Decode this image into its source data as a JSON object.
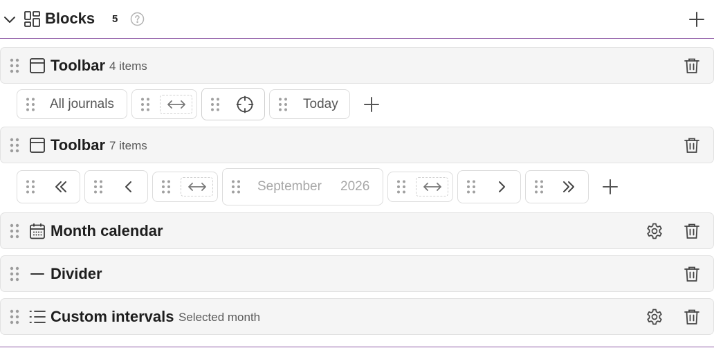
{
  "section": {
    "title": "Blocks",
    "count": "5",
    "icons": {
      "collapse": "chevron-down-icon",
      "section": "blocks-grid-icon",
      "help": "help-circle-icon",
      "add": "plus-icon"
    }
  },
  "blocks": [
    {
      "type_icon": "toolbar-icon",
      "title": "Toolbar",
      "meta": "4 items",
      "has_settings": false,
      "items": [
        {
          "kind": "text",
          "label": "All journals"
        },
        {
          "kind": "spacer",
          "icon": "horizontal-expand-icon"
        },
        {
          "kind": "icon",
          "icon": "crosshair-icon"
        },
        {
          "kind": "text",
          "label": "Today"
        }
      ]
    },
    {
      "type_icon": "toolbar-icon",
      "title": "Toolbar",
      "meta": "7 items",
      "has_settings": false,
      "items": [
        {
          "kind": "icon",
          "icon": "double-chevron-left-icon"
        },
        {
          "kind": "icon",
          "icon": "chevron-left-icon"
        },
        {
          "kind": "spacer",
          "icon": "horizontal-expand-icon"
        },
        {
          "kind": "date",
          "month": "September",
          "year": "2026"
        },
        {
          "kind": "spacer",
          "icon": "horizontal-expand-icon"
        },
        {
          "kind": "icon",
          "icon": "chevron-right-icon"
        },
        {
          "kind": "icon",
          "icon": "double-chevron-right-icon"
        }
      ]
    },
    {
      "type_icon": "calendar-icon",
      "title": "Month calendar",
      "meta": "",
      "has_settings": true
    },
    {
      "type_icon": "minus-icon",
      "title": "Divider",
      "meta": "",
      "has_settings": false
    },
    {
      "type_icon": "list-icon",
      "title": "Custom intervals",
      "meta": "Selected month",
      "has_settings": true
    }
  ],
  "colors": {
    "accent_line": "#8e5aa6",
    "row_bg": "#f5f5f5",
    "text": "#222222",
    "muted": "#a7a7a7"
  }
}
